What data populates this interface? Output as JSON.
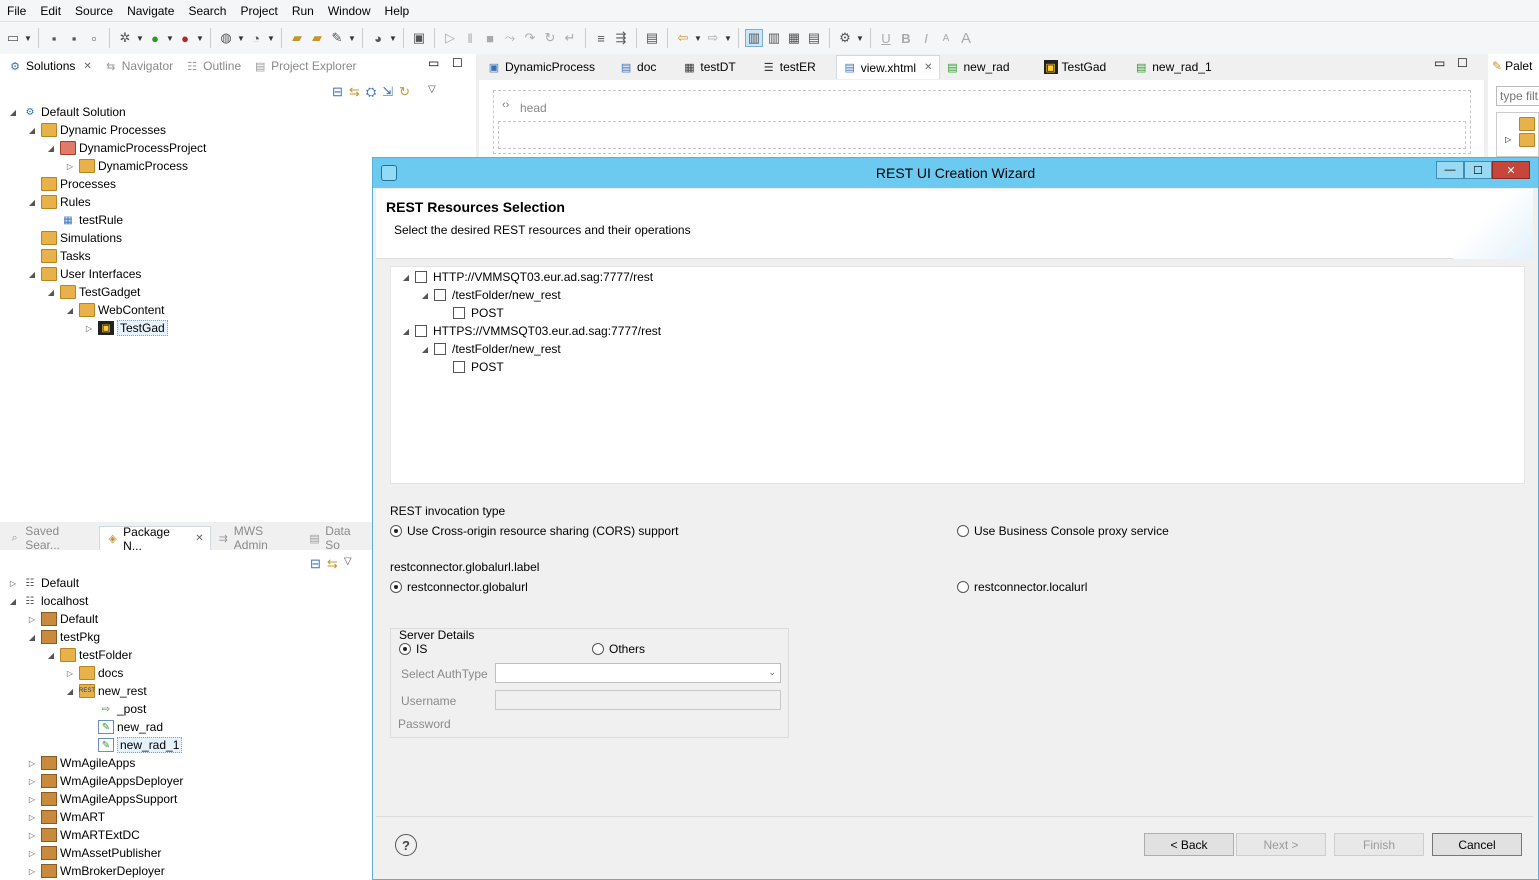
{
  "menu": [
    "File",
    "Edit",
    "Source",
    "Navigate",
    "Search",
    "Project",
    "Run",
    "Window",
    "Help"
  ],
  "left_top_tabs": [
    {
      "label": "Solutions",
      "active": true
    },
    {
      "label": "Navigator",
      "active": false
    },
    {
      "label": "Outline",
      "active": false
    },
    {
      "label": "Project Explorer",
      "active": false
    }
  ],
  "solutions_tree": [
    {
      "label": "Default Solution"
    },
    {
      "label": "Dynamic Processes"
    },
    {
      "label": "DynamicProcessProject"
    },
    {
      "label": "DynamicProcess"
    },
    {
      "label": "Processes"
    },
    {
      "label": "Rules"
    },
    {
      "label": "testRule"
    },
    {
      "label": "Simulations"
    },
    {
      "label": "Tasks"
    },
    {
      "label": "User Interfaces"
    },
    {
      "label": "TestGadget"
    },
    {
      "label": "WebContent"
    },
    {
      "label": "TestGad"
    }
  ],
  "editor_tabs": [
    {
      "label": "DynamicProcess"
    },
    {
      "label": "doc"
    },
    {
      "label": "testDT"
    },
    {
      "label": "testER"
    },
    {
      "label": "view.xhtml",
      "active": true
    },
    {
      "label": "new_rad"
    },
    {
      "label": "TestGad"
    },
    {
      "label": "new_rad_1"
    }
  ],
  "editor": {
    "head_label": "head"
  },
  "palette": {
    "tab_label": "Palet",
    "filter_placeholder": "type filt"
  },
  "left_bottom_tabs": [
    {
      "label": "Saved Sear..."
    },
    {
      "label": "Package N...",
      "active": true
    },
    {
      "label": "MWS Admin"
    },
    {
      "label": "Data So"
    }
  ],
  "package_tree": [
    {
      "label": "Default"
    },
    {
      "label": "localhost"
    },
    {
      "label": "Default"
    },
    {
      "label": "testPkg"
    },
    {
      "label": "testFolder"
    },
    {
      "label": "docs"
    },
    {
      "label": "new_rest"
    },
    {
      "label": "_post"
    },
    {
      "label": "new_rad"
    },
    {
      "label": "new_rad_1"
    },
    {
      "label": "WmAgileApps"
    },
    {
      "label": "WmAgileAppsDeployer"
    },
    {
      "label": "WmAgileAppsSupport"
    },
    {
      "label": "WmART"
    },
    {
      "label": "WmARTExtDC"
    },
    {
      "label": "WmAssetPublisher"
    },
    {
      "label": "WmBrokerDeployer"
    }
  ],
  "dialog": {
    "title": "REST UI Creation Wizard",
    "header_title": "REST Resources Selection",
    "header_subtitle": "Select the desired REST resources and their operations",
    "resources": [
      {
        "label": "HTTP://VMMSQT03.eur.ad.sag:7777/rest"
      },
      {
        "label": "/testFolder/new_rest"
      },
      {
        "label": "POST"
      },
      {
        "label": "HTTPS://VMMSQT03.eur.ad.sag:7777/rest"
      },
      {
        "label": "/testFolder/new_rest"
      },
      {
        "label": "POST"
      }
    ],
    "invocation_label": "REST invocation type",
    "invocation_options": [
      "Use Cross-origin resource sharing (CORS) support",
      "Use Business Console proxy service"
    ],
    "invocation_selected": 0,
    "url_label": "restconnector.globalurl.label",
    "url_options": [
      "restconnector.globalurl",
      "restconnector.localurl"
    ],
    "url_selected": 0,
    "server": {
      "group_label": "Server Details",
      "options": [
        "IS",
        "Others"
      ],
      "selected": 0,
      "auth_label": "Select AuthType",
      "auth_value": "",
      "username_label": "Username",
      "username_value": "",
      "password_label": "Password"
    },
    "buttons": {
      "back": "< Back",
      "next": "Next >",
      "finish": "Finish",
      "cancel": "Cancel",
      "help": "?"
    }
  }
}
